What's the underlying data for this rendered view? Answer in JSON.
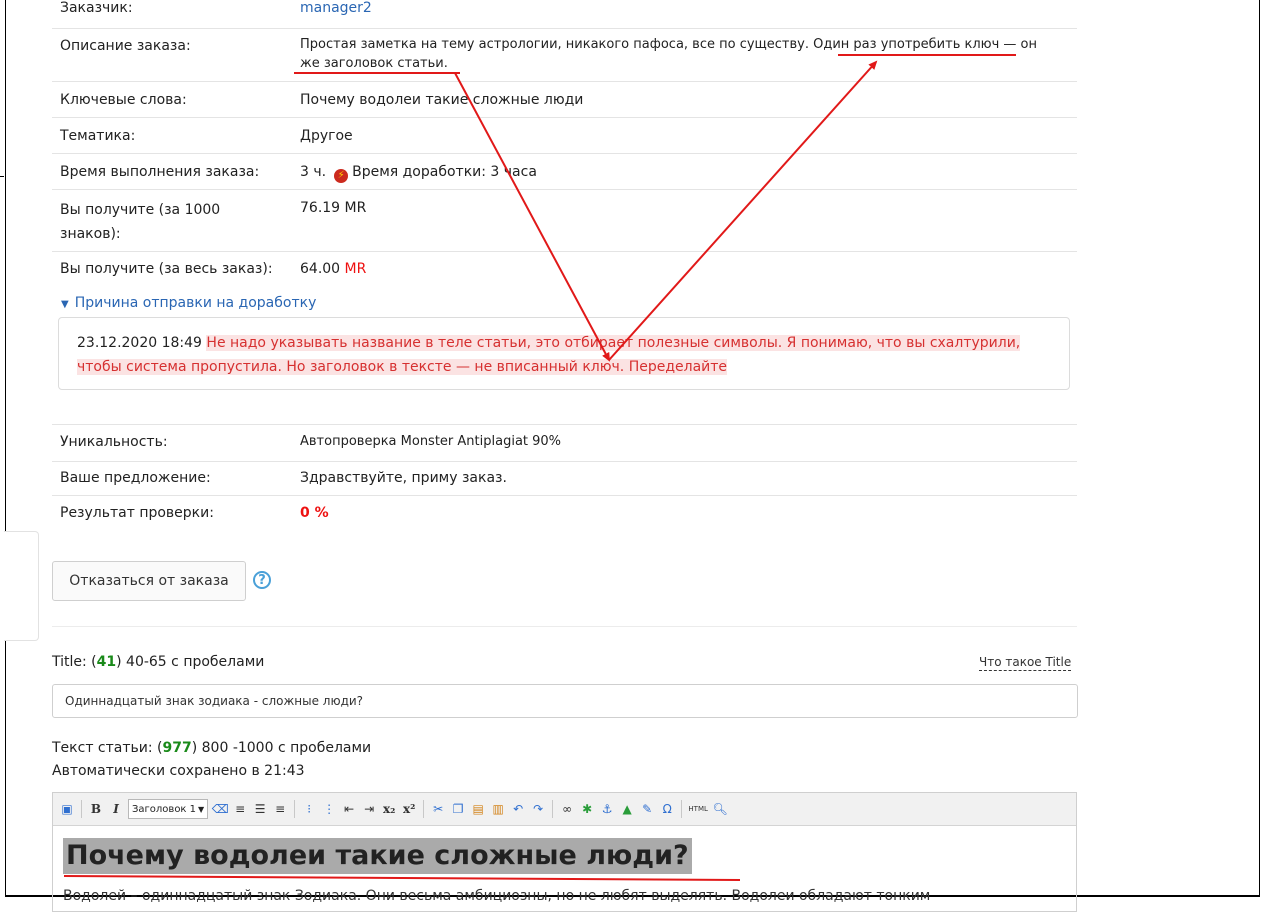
{
  "order": {
    "rows": [
      {
        "label": "Заказчик:",
        "value": "manager2"
      },
      {
        "label": "Описание заказа:",
        "value_line1": "Простая заметка на тему астрологии, никакого пафоса, все по существу. Один раз употребить ключ — он",
        "value_line2": "же заголовок статьи."
      },
      {
        "label": "Ключевые слова:",
        "value": "Почему водолеи такие сложные люди"
      },
      {
        "label": "Тематика:",
        "value": "Другое"
      },
      {
        "label": "Время выполнения заказа:",
        "value": "3 ч.",
        "extra": "Время доработки: 3 часа"
      },
      {
        "label": "Вы получите (за 1000 знаков):",
        "value": "76.19 MR"
      },
      {
        "label": "Вы получите (за весь заказ):",
        "value": "64.00",
        "currency": "MR"
      }
    ],
    "rows2": [
      {
        "label": "Уникальность:",
        "value": "Автопроверка Monster Antiplagiat 90%"
      },
      {
        "label": "Ваше предложение:",
        "value": "Здравствуйте, приму заказ."
      },
      {
        "label": "Результат проверки:",
        "value": "0 %"
      }
    ]
  },
  "reason": {
    "toggle_label": "Причина отправки на доработку",
    "date": "23.12.2020 18:49",
    "text": "Не надо указывать название в теле статьи, это отбирает полезные символы. Я понимаю, что вы схалтурили, чтобы система пропустила. Но заголовок в тексте — не вписанный ключ. Переделайте"
  },
  "actions": {
    "refuse_button": "Отказаться от заказа",
    "help": "?"
  },
  "title_field": {
    "label_prefix": "Title: (",
    "count": "41",
    "label_suffix": ") 40-65 с пробелами",
    "help_link": "Что такое Title",
    "value": "Одиннадцатый знак зодиака - сложные люди?"
  },
  "text_field": {
    "label_prefix": "Текст статьи: (",
    "count": "977",
    "label_suffix": ") 800 -1000 с пробелами",
    "autosave": "Автоматически сохранено в 21:43"
  },
  "editor": {
    "format_select": "Заголовок 1",
    "html_button": "HTML",
    "heading": "Почему водолеи такие сложные люди?",
    "first_line": "Водолей – одиннадцатый знак Зодиака. Они весьма амбициозны, но не любят выделять. Водолеи обладают тонким"
  },
  "colors": {
    "link": "#2a66b3",
    "warning": "#d63030",
    "count": "#1a8a1a",
    "annotation": "#e11919"
  }
}
